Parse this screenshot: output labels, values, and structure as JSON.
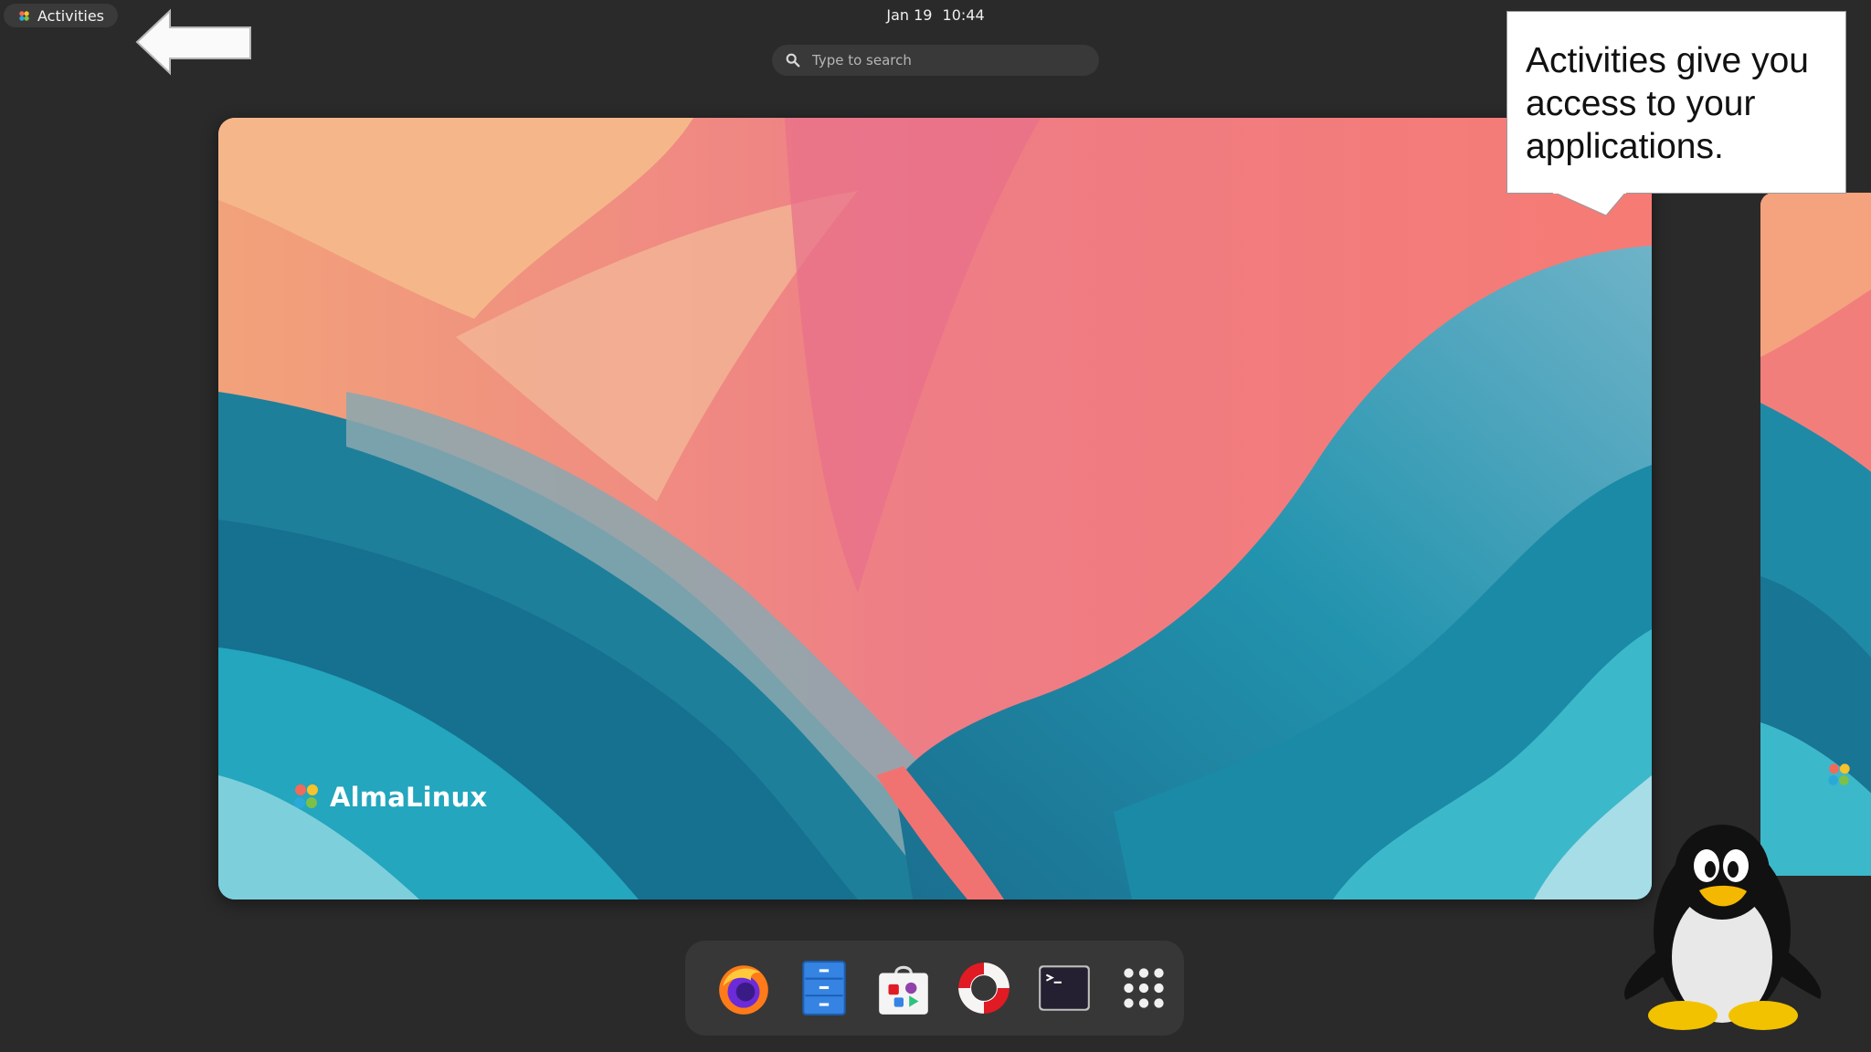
{
  "topbar": {
    "activities_label": "Activities",
    "date": "Jan 19",
    "time": "10:44"
  },
  "search": {
    "placeholder": "Type to search"
  },
  "workspace": {
    "brand_name": "AlmaLinux"
  },
  "callout": {
    "text": "Activities give you access to your applications."
  },
  "dock": {
    "items": [
      {
        "name": "firefox",
        "icon": "firefox-icon"
      },
      {
        "name": "files",
        "icon": "files-icon"
      },
      {
        "name": "software",
        "icon": "software-icon"
      },
      {
        "name": "help",
        "icon": "lifebuoy-icon"
      },
      {
        "name": "terminal",
        "icon": "terminal-icon"
      },
      {
        "name": "show-apps",
        "icon": "app-grid-icon"
      }
    ]
  },
  "colors": {
    "background": "#2a2a2a",
    "panel": "#3a3a3a",
    "wallpaper_pink": "#f07a78",
    "wallpaper_teal": "#1f8fa8"
  }
}
